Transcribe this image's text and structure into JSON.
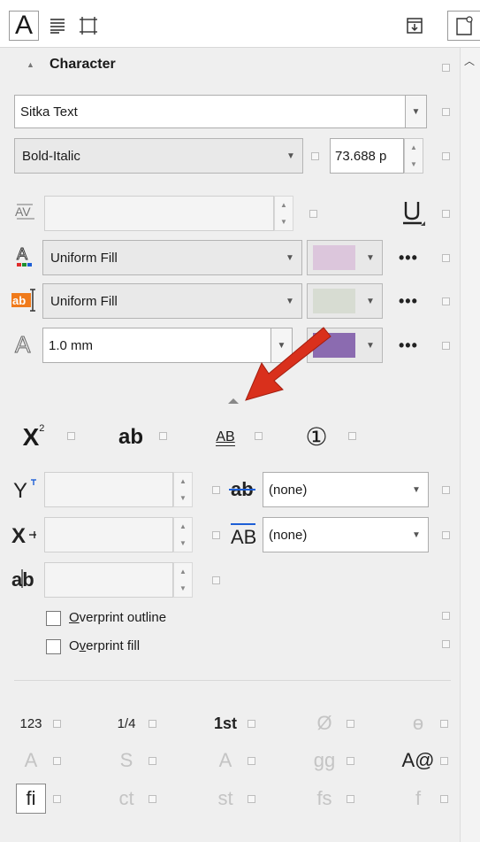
{
  "tabs": {
    "character_tab_glyph": "A",
    "paragraph_tab_icon": "paragraph-lines-icon",
    "frame_tab_icon": "frame-icon"
  },
  "section": {
    "title": "Character",
    "collapse_glyph": "▲"
  },
  "font": {
    "family": "Sitka Text",
    "style": "Bold-Italic",
    "size": "73.688 p"
  },
  "fills": {
    "text_fill": "Uniform Fill",
    "text_fill_color": "#dcc6dc",
    "background_fill": "Uniform Fill",
    "background_fill_color": "#d7dcd2",
    "outline_width": "1.0 mm",
    "outline_color": "#8b6bb0",
    "more_label": "•••"
  },
  "position": {
    "superscript_glyph": "X",
    "superscript_exp": "2",
    "subscript_glyph": "ab",
    "underline_glyph": "AB",
    "numeral_glyph": "①"
  },
  "offsets": {
    "strikethrough": "(none)",
    "overline": "(none)"
  },
  "overprint": {
    "outline_label_prefix": "",
    "outline_label_underlined": "O",
    "outline_label_rest": "verprint outline",
    "fill_label_prefix": "O",
    "fill_label_underlined": "v",
    "fill_label_rest": "erprint fill"
  },
  "opentype": {
    "row1": [
      "123",
      "1/4",
      "1st",
      "Ø",
      "ɵ"
    ],
    "row2": [
      "A",
      "S",
      "A",
      "gg",
      "A@"
    ],
    "row3": [
      "fi",
      "ct",
      "st",
      "fs",
      "f"
    ]
  },
  "colors": {
    "annotation_arrow": "#d9301c"
  }
}
